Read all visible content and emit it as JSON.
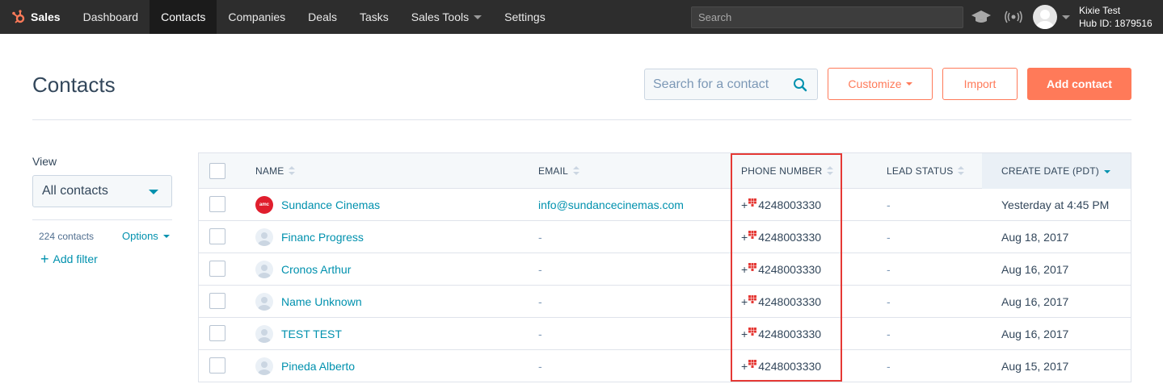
{
  "topnav": {
    "brand": "Sales",
    "items": [
      {
        "label": "Dashboard",
        "active": false
      },
      {
        "label": "Contacts",
        "active": true
      },
      {
        "label": "Companies",
        "active": false
      },
      {
        "label": "Deals",
        "active": false
      },
      {
        "label": "Tasks",
        "active": false
      },
      {
        "label": "Sales Tools",
        "active": false,
        "dropdown": true
      },
      {
        "label": "Settings",
        "active": false
      }
    ],
    "search_placeholder": "Search",
    "user_name": "Kixie Test",
    "hub_id": "Hub ID: 1879516"
  },
  "header": {
    "title": "Contacts",
    "search_placeholder": "Search for a contact",
    "customize_label": "Customize",
    "import_label": "Import",
    "add_contact_label": "Add contact"
  },
  "sidebar": {
    "view_label": "View",
    "view_selected": "All contacts",
    "count": "224 contacts",
    "options_label": "Options",
    "add_filter_label": "Add filter"
  },
  "table": {
    "columns": [
      "NAME",
      "EMAIL",
      "PHONE NUMBER",
      "LEAD STATUS",
      "CREATE DATE (PDT)"
    ],
    "rows": [
      {
        "name": "Sundance Cinemas",
        "logo": "amc",
        "email": "info@sundancecinemas.com",
        "phone_prefix": "+",
        "phone": "4248003330",
        "lead_status": "-",
        "create_date": "Yesterday at 4:45 PM"
      },
      {
        "name": "Financ Progress",
        "logo": "",
        "email": "-",
        "phone_prefix": "+",
        "phone": "4248003330",
        "lead_status": "-",
        "create_date": "Aug 18, 2017"
      },
      {
        "name": "Cronos Arthur",
        "logo": "",
        "email": "-",
        "phone_prefix": "+",
        "phone": "4248003330",
        "lead_status": "-",
        "create_date": "Aug 16, 2017"
      },
      {
        "name": "Name Unknown",
        "logo": "",
        "email": "-",
        "phone_prefix": "+",
        "phone": "4248003330",
        "lead_status": "-",
        "create_date": "Aug 16, 2017"
      },
      {
        "name": "TEST TEST",
        "logo": "",
        "email": "-",
        "phone_prefix": "+",
        "phone": "4248003330",
        "lead_status": "-",
        "create_date": "Aug 16, 2017"
      },
      {
        "name": "Pineda Alberto",
        "logo": "",
        "email": "-",
        "phone_prefix": "+",
        "phone": "4248003330",
        "lead_status": "-",
        "create_date": "Aug 15, 2017"
      }
    ]
  },
  "colors": {
    "accent": "#ff7a59",
    "link": "#0091ae",
    "text": "#33475b",
    "highlight": "#e53935",
    "nav_bg": "#2d2d2d"
  }
}
